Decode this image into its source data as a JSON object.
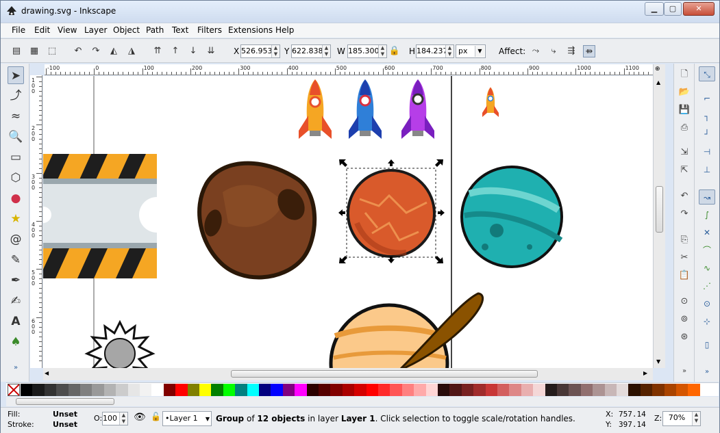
{
  "window": {
    "title": "drawing.svg - Inkscape",
    "minimize": "▁",
    "maximize": "▢",
    "close": "✕"
  },
  "menu": [
    "File",
    "Edit",
    "View",
    "Layer",
    "Object",
    "Path",
    "Text",
    "Filters",
    "Extensions",
    "Help"
  ],
  "toolbar": {
    "x_label": "X",
    "x_value": "526.953",
    "y_label": "Y",
    "y_value": "622.838",
    "w_label": "W",
    "w_value": "185.300",
    "h_label": "H",
    "h_value": "184.237",
    "unit": "px",
    "affect_label": "Affect:"
  },
  "ruler": {
    "h_labels": [
      "-100",
      "0",
      "100",
      "200",
      "300",
      "400",
      "500",
      "600",
      "700",
      "800",
      "900",
      "1000",
      "1100"
    ],
    "v_labels": [
      "1",
      "0",
      "0",
      "2",
      "0",
      "0",
      "3",
      "0",
      "0",
      "4",
      "0",
      "0",
      "5",
      "0",
      "0",
      "6",
      "0",
      "0"
    ]
  },
  "left_tools": [
    "selector-tool",
    "node-tool",
    "tweak-tool",
    "zoom-tool",
    "rect-tool",
    "3dbox-tool",
    "ellipse-tool",
    "star-tool",
    "spiral-tool",
    "pencil-tool",
    "pen-tool",
    "calligraphy-tool",
    "text-tool",
    "spray-tool"
  ],
  "palette": {
    "colors": [
      "#000000",
      "#1a1a1a",
      "#333333",
      "#4d4d4d",
      "#666666",
      "#808080",
      "#999999",
      "#b3b3b3",
      "#cccccc",
      "#e6e6e6",
      "#f2f2f2",
      "#ffffff",
      "#800000",
      "#ff0000",
      "#808000",
      "#ffff00",
      "#008000",
      "#00ff00",
      "#008080",
      "#00ffff",
      "#000080",
      "#0000ff",
      "#800080",
      "#ff00ff",
      "#2b0000",
      "#550000",
      "#800000",
      "#aa0000",
      "#d40000",
      "#ff0000",
      "#ff2a2a",
      "#ff5555",
      "#ff8080",
      "#ffaaaa",
      "#ffd5d5",
      "#280b0b",
      "#501616",
      "#782121",
      "#a02c2c",
      "#c83737",
      "#d35f5f",
      "#de8787",
      "#e9afaf",
      "#f4d7d7",
      "#241c1c",
      "#483737",
      "#6c5353",
      "#916f6f",
      "#ac9393",
      "#c8b7b7",
      "#e3dbdb",
      "#2b1100",
      "#552200",
      "#803300",
      "#aa4400",
      "#d45500",
      "#ff6600"
    ]
  },
  "status": {
    "fill_label": "Fill:",
    "fill_value": "Unset",
    "stroke_label": "Stroke:",
    "stroke_value": "Unset",
    "opacity_label": "O:",
    "opacity_value": "100",
    "layer": "•Layer 1",
    "message_prefix": "Group",
    "message_mid1": " of ",
    "message_count": "12 objects",
    "message_mid2": " in layer ",
    "message_layer": "Layer 1",
    "message_suffix": ". Click selection to toggle scale/rotation handles.",
    "x_label": "X:",
    "x_value": "757.14",
    "y_label": "Y:",
    "y_value": "397.14",
    "zoom_label": "Z:",
    "zoom_value": "70%"
  }
}
